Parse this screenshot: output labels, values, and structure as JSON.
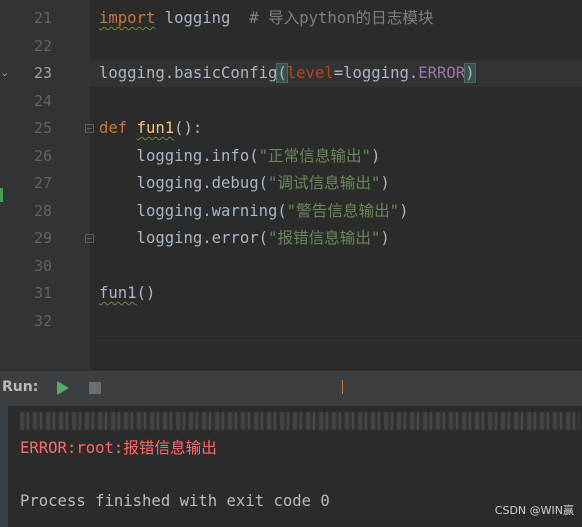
{
  "editor": {
    "line_numbers": [
      "21",
      "22",
      "23",
      "24",
      "25",
      "26",
      "27",
      "28",
      "29",
      "30",
      "31",
      "32"
    ],
    "current_line": "23",
    "lines": {
      "l21": {
        "kw": "import",
        "rest": " logging  ",
        "comment": "# 导入python的日志模块"
      },
      "l23": {
        "prefix": "logging.basicConfig",
        "open": "(",
        "param": "level",
        "eq": "=logging.",
        "const": "ERROR",
        "close": ")"
      },
      "l25": {
        "kw": "def",
        "space": " ",
        "fn": "fun1",
        "rest": "():"
      },
      "l26": {
        "prefix": "    logging.info(",
        "str": "\"正常信息输出\"",
        "suffix": ")"
      },
      "l27": {
        "prefix": "    logging.debug(",
        "str": "\"调试信息输出\"",
        "suffix": ")"
      },
      "l28": {
        "prefix": "    logging.warning(",
        "str": "\"警告信息输出\"",
        "suffix": ")"
      },
      "l29": {
        "prefix": "    logging.error(",
        "str": "\"报错信息输出\"",
        "suffix": ")"
      },
      "l31": {
        "fn": "fun1",
        "rest": "()"
      }
    }
  },
  "run_panel": {
    "label": "Run:",
    "play_icon": "play-icon",
    "stop_icon": "stop-icon"
  },
  "console": {
    "error_line": "ERROR:root:报错信息输出",
    "exit_line": "Process finished with exit code 0"
  },
  "watermark": "CSDN @WIN赢",
  "colors": {
    "background": "#2b2b2b",
    "keyword": "#cc7832",
    "string": "#6a8759",
    "function": "#ffc66d",
    "error_text": "#ff6b68"
  }
}
